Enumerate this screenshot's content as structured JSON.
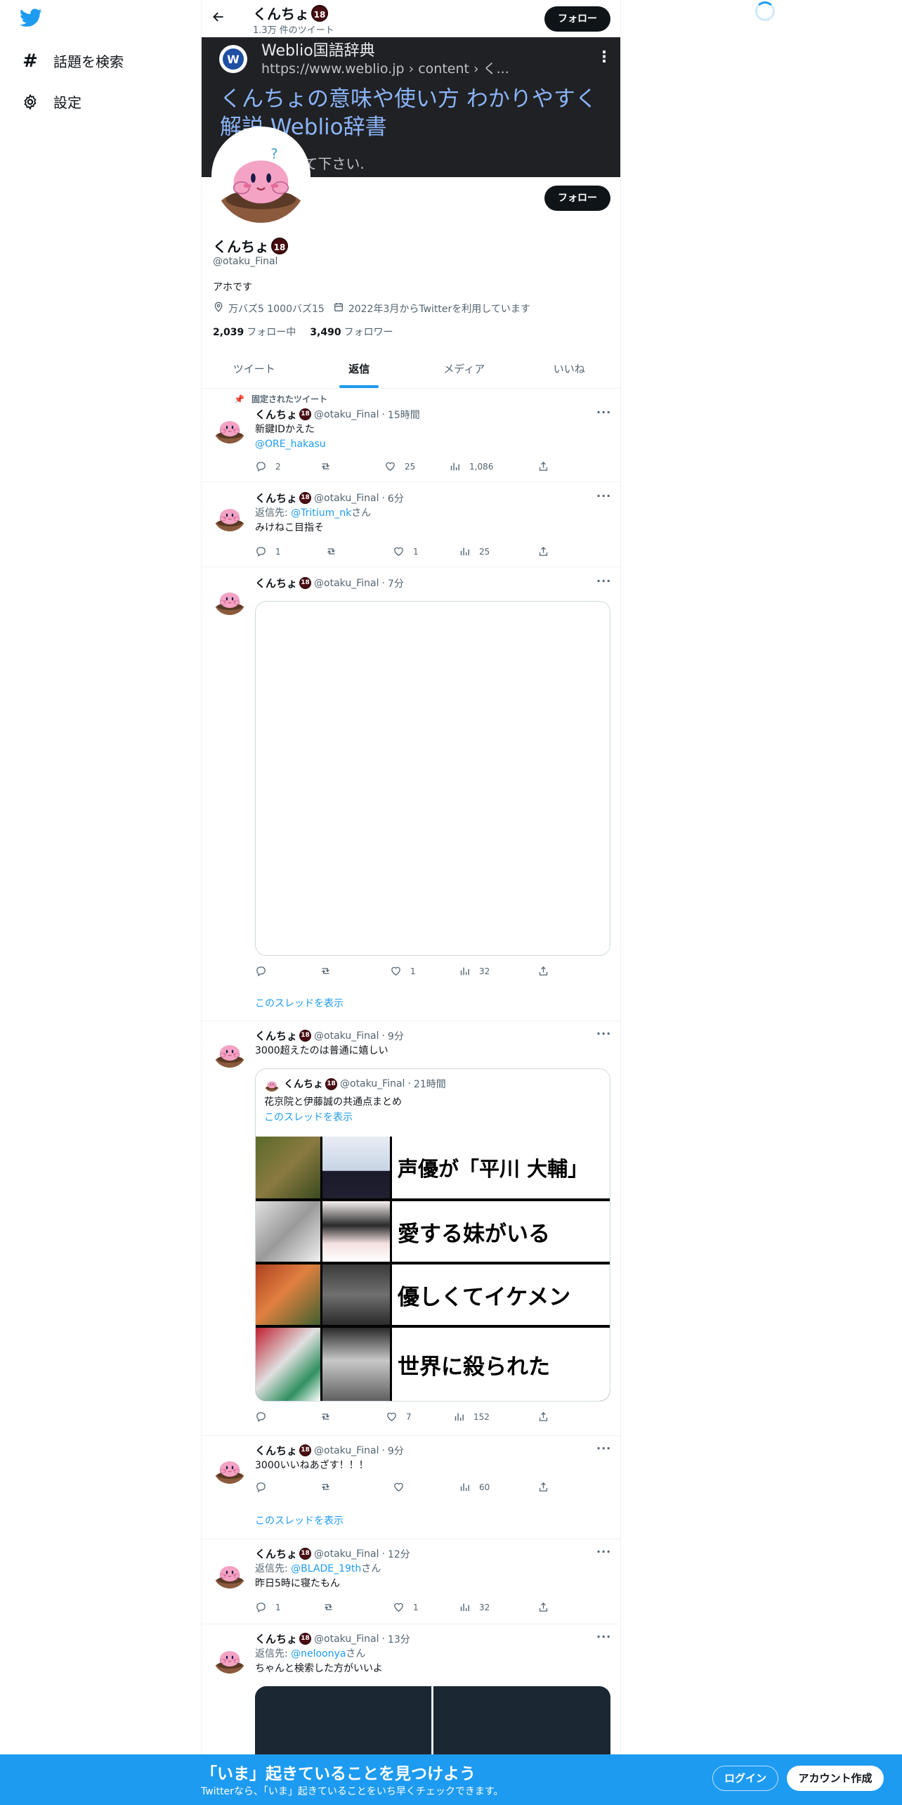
{
  "nav": {
    "explore_label": "話題を検索",
    "settings_label": "設定"
  },
  "header": {
    "name": "くんちょ",
    "badge": "18",
    "tweet_count": "1.3万 件のツイート",
    "follow_label": "フォロー"
  },
  "banner": {
    "site_name": "Weblio国語辞典",
    "url": "https://www.weblio.jp › content › く...",
    "logo_letter": "W",
    "title": "くんちょの意味や使い方 わかりやすく解説 Weblio辞書",
    "desc": "茨城弁。〜して下さい."
  },
  "profile": {
    "name": "くんちょ",
    "badge": "18",
    "handle": "@otaku_Final",
    "bio": "アホです",
    "location": "万バズ5 1000バズ15",
    "joined": "2022年3月からTwitterを利用しています",
    "following_count": "2,039",
    "following_label": "フォロー中",
    "followers_count": "3,490",
    "followers_label": "フォロワー",
    "follow_label": "フォロー"
  },
  "tabs": [
    {
      "label": "ツイート"
    },
    {
      "label": "返信"
    },
    {
      "label": "メディア"
    },
    {
      "label": "いいね"
    }
  ],
  "pinned_label": "固定されたツイート",
  "reply_to_label": "返信先:",
  "reply_suffix": "さん",
  "show_thread_label": "このスレッドを表示",
  "tweets": [
    {
      "name": "くんちょ",
      "badge": "18",
      "handle": "@otaku_Final",
      "time": "15時間",
      "text": "新鍵IDかえた",
      "mention": "@ORE_hakasu",
      "replies": "2",
      "retweets": "",
      "likes": "25",
      "views": "1,086"
    },
    {
      "name": "くんちょ",
      "badge": "18",
      "handle": "@otaku_Final",
      "time": "6分",
      "reply_to": "@Tritium_nk",
      "text": "みけねこ目指そ",
      "replies": "1",
      "retweets": "",
      "likes": "1",
      "views": "25"
    },
    {
      "name": "くんちょ",
      "badge": "18",
      "handle": "@otaku_Final",
      "time": "7分",
      "replies": "",
      "retweets": "",
      "likes": "1",
      "views": "32"
    },
    {
      "name": "くんちょ",
      "badge": "18",
      "handle": "@otaku_Final",
      "time": "9分",
      "text": "3000超えたのは普通に嬉しい",
      "quote": {
        "name": "くんちょ",
        "badge": "18",
        "handle": "@otaku_Final",
        "time": "21時間",
        "text": "花京院と伊藤誠の共通点まとめ",
        "captions": [
          "声優が「平川 大輔」",
          "愛する妹がいる",
          "優しくてイケメン",
          "世界に殺られた"
        ]
      },
      "replies": "",
      "retweets": "",
      "likes": "7",
      "views": "152"
    },
    {
      "name": "くんちょ",
      "badge": "18",
      "handle": "@otaku_Final",
      "time": "9分",
      "text": "3000いいねあざす！！！",
      "replies": "",
      "retweets": "",
      "likes": "",
      "views": "60"
    },
    {
      "name": "くんちょ",
      "badge": "18",
      "handle": "@otaku_Final",
      "time": "12分",
      "reply_to": "@BLADE_19th",
      "text": "昨日5時に寝たもん",
      "replies": "1",
      "retweets": "",
      "likes": "1",
      "views": "32"
    },
    {
      "name": "くんちょ",
      "badge": "18",
      "handle": "@otaku_Final",
      "time": "13分",
      "reply_to": "@neloonya",
      "text": "ちゃんと検索した方がいいよ"
    }
  ],
  "bottom": {
    "title": "「いま」起きていることを見つけよう",
    "subtitle": "Twitterなら、「いま」起きていることをいち早くチェックできます。",
    "login_label": "ログイン",
    "signup_label": "アカウント作成"
  },
  "colors": {
    "accent": "#1d9bf0",
    "banner_bg": "#202124",
    "link_blue": "#8ab4f8"
  }
}
